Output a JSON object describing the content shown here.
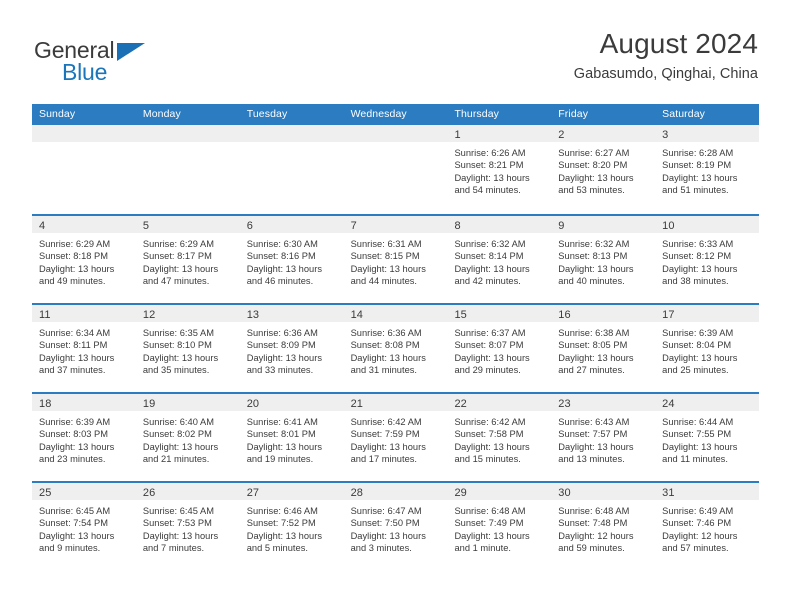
{
  "brand": {
    "name_part1": "General",
    "name_part2": "Blue",
    "triangle_color": "#1b6fb4"
  },
  "header": {
    "title": "August 2024",
    "subtitle": "Gabasumdo, Qinghai, China"
  },
  "theme": {
    "header_blue": "#2b7cc0",
    "day_band_gray": "#efefef",
    "text_color": "#3b3b3b"
  },
  "calendar": {
    "weekday_headers": [
      "Sunday",
      "Monday",
      "Tuesday",
      "Wednesday",
      "Thursday",
      "Friday",
      "Saturday"
    ],
    "weeks": [
      [
        {
          "day": "",
          "sunrise": "",
          "sunset": "",
          "daylight": "",
          "empty": true
        },
        {
          "day": "",
          "sunrise": "",
          "sunset": "",
          "daylight": "",
          "empty": true
        },
        {
          "day": "",
          "sunrise": "",
          "sunset": "",
          "daylight": "",
          "empty": true
        },
        {
          "day": "",
          "sunrise": "",
          "sunset": "",
          "daylight": "",
          "empty": true
        },
        {
          "day": "1",
          "sunrise": "Sunrise: 6:26 AM",
          "sunset": "Sunset: 8:21 PM",
          "daylight": "Daylight: 13 hours and 54 minutes.",
          "empty": false
        },
        {
          "day": "2",
          "sunrise": "Sunrise: 6:27 AM",
          "sunset": "Sunset: 8:20 PM",
          "daylight": "Daylight: 13 hours and 53 minutes.",
          "empty": false
        },
        {
          "day": "3",
          "sunrise": "Sunrise: 6:28 AM",
          "sunset": "Sunset: 8:19 PM",
          "daylight": "Daylight: 13 hours and 51 minutes.",
          "empty": false
        }
      ],
      [
        {
          "day": "4",
          "sunrise": "Sunrise: 6:29 AM",
          "sunset": "Sunset: 8:18 PM",
          "daylight": "Daylight: 13 hours and 49 minutes.",
          "empty": false
        },
        {
          "day": "5",
          "sunrise": "Sunrise: 6:29 AM",
          "sunset": "Sunset: 8:17 PM",
          "daylight": "Daylight: 13 hours and 47 minutes.",
          "empty": false
        },
        {
          "day": "6",
          "sunrise": "Sunrise: 6:30 AM",
          "sunset": "Sunset: 8:16 PM",
          "daylight": "Daylight: 13 hours and 46 minutes.",
          "empty": false
        },
        {
          "day": "7",
          "sunrise": "Sunrise: 6:31 AM",
          "sunset": "Sunset: 8:15 PM",
          "daylight": "Daylight: 13 hours and 44 minutes.",
          "empty": false
        },
        {
          "day": "8",
          "sunrise": "Sunrise: 6:32 AM",
          "sunset": "Sunset: 8:14 PM",
          "daylight": "Daylight: 13 hours and 42 minutes.",
          "empty": false
        },
        {
          "day": "9",
          "sunrise": "Sunrise: 6:32 AM",
          "sunset": "Sunset: 8:13 PM",
          "daylight": "Daylight: 13 hours and 40 minutes.",
          "empty": false
        },
        {
          "day": "10",
          "sunrise": "Sunrise: 6:33 AM",
          "sunset": "Sunset: 8:12 PM",
          "daylight": "Daylight: 13 hours and 38 minutes.",
          "empty": false
        }
      ],
      [
        {
          "day": "11",
          "sunrise": "Sunrise: 6:34 AM",
          "sunset": "Sunset: 8:11 PM",
          "daylight": "Daylight: 13 hours and 37 minutes.",
          "empty": false
        },
        {
          "day": "12",
          "sunrise": "Sunrise: 6:35 AM",
          "sunset": "Sunset: 8:10 PM",
          "daylight": "Daylight: 13 hours and 35 minutes.",
          "empty": false
        },
        {
          "day": "13",
          "sunrise": "Sunrise: 6:36 AM",
          "sunset": "Sunset: 8:09 PM",
          "daylight": "Daylight: 13 hours and 33 minutes.",
          "empty": false
        },
        {
          "day": "14",
          "sunrise": "Sunrise: 6:36 AM",
          "sunset": "Sunset: 8:08 PM",
          "daylight": "Daylight: 13 hours and 31 minutes.",
          "empty": false
        },
        {
          "day": "15",
          "sunrise": "Sunrise: 6:37 AM",
          "sunset": "Sunset: 8:07 PM",
          "daylight": "Daylight: 13 hours and 29 minutes.",
          "empty": false
        },
        {
          "day": "16",
          "sunrise": "Sunrise: 6:38 AM",
          "sunset": "Sunset: 8:05 PM",
          "daylight": "Daylight: 13 hours and 27 minutes.",
          "empty": false
        },
        {
          "day": "17",
          "sunrise": "Sunrise: 6:39 AM",
          "sunset": "Sunset: 8:04 PM",
          "daylight": "Daylight: 13 hours and 25 minutes.",
          "empty": false
        }
      ],
      [
        {
          "day": "18",
          "sunrise": "Sunrise: 6:39 AM",
          "sunset": "Sunset: 8:03 PM",
          "daylight": "Daylight: 13 hours and 23 minutes.",
          "empty": false
        },
        {
          "day": "19",
          "sunrise": "Sunrise: 6:40 AM",
          "sunset": "Sunset: 8:02 PM",
          "daylight": "Daylight: 13 hours and 21 minutes.",
          "empty": false
        },
        {
          "day": "20",
          "sunrise": "Sunrise: 6:41 AM",
          "sunset": "Sunset: 8:01 PM",
          "daylight": "Daylight: 13 hours and 19 minutes.",
          "empty": false
        },
        {
          "day": "21",
          "sunrise": "Sunrise: 6:42 AM",
          "sunset": "Sunset: 7:59 PM",
          "daylight": "Daylight: 13 hours and 17 minutes.",
          "empty": false
        },
        {
          "day": "22",
          "sunrise": "Sunrise: 6:42 AM",
          "sunset": "Sunset: 7:58 PM",
          "daylight": "Daylight: 13 hours and 15 minutes.",
          "empty": false
        },
        {
          "day": "23",
          "sunrise": "Sunrise: 6:43 AM",
          "sunset": "Sunset: 7:57 PM",
          "daylight": "Daylight: 13 hours and 13 minutes.",
          "empty": false
        },
        {
          "day": "24",
          "sunrise": "Sunrise: 6:44 AM",
          "sunset": "Sunset: 7:55 PM",
          "daylight": "Daylight: 13 hours and 11 minutes.",
          "empty": false
        }
      ],
      [
        {
          "day": "25",
          "sunrise": "Sunrise: 6:45 AM",
          "sunset": "Sunset: 7:54 PM",
          "daylight": "Daylight: 13 hours and 9 minutes.",
          "empty": false
        },
        {
          "day": "26",
          "sunrise": "Sunrise: 6:45 AM",
          "sunset": "Sunset: 7:53 PM",
          "daylight": "Daylight: 13 hours and 7 minutes.",
          "empty": false
        },
        {
          "day": "27",
          "sunrise": "Sunrise: 6:46 AM",
          "sunset": "Sunset: 7:52 PM",
          "daylight": "Daylight: 13 hours and 5 minutes.",
          "empty": false
        },
        {
          "day": "28",
          "sunrise": "Sunrise: 6:47 AM",
          "sunset": "Sunset: 7:50 PM",
          "daylight": "Daylight: 13 hours and 3 minutes.",
          "empty": false
        },
        {
          "day": "29",
          "sunrise": "Sunrise: 6:48 AM",
          "sunset": "Sunset: 7:49 PM",
          "daylight": "Daylight: 13 hours and 1 minute.",
          "empty": false
        },
        {
          "day": "30",
          "sunrise": "Sunrise: 6:48 AM",
          "sunset": "Sunset: 7:48 PM",
          "daylight": "Daylight: 12 hours and 59 minutes.",
          "empty": false
        },
        {
          "day": "31",
          "sunrise": "Sunrise: 6:49 AM",
          "sunset": "Sunset: 7:46 PM",
          "daylight": "Daylight: 12 hours and 57 minutes.",
          "empty": false
        }
      ]
    ]
  }
}
